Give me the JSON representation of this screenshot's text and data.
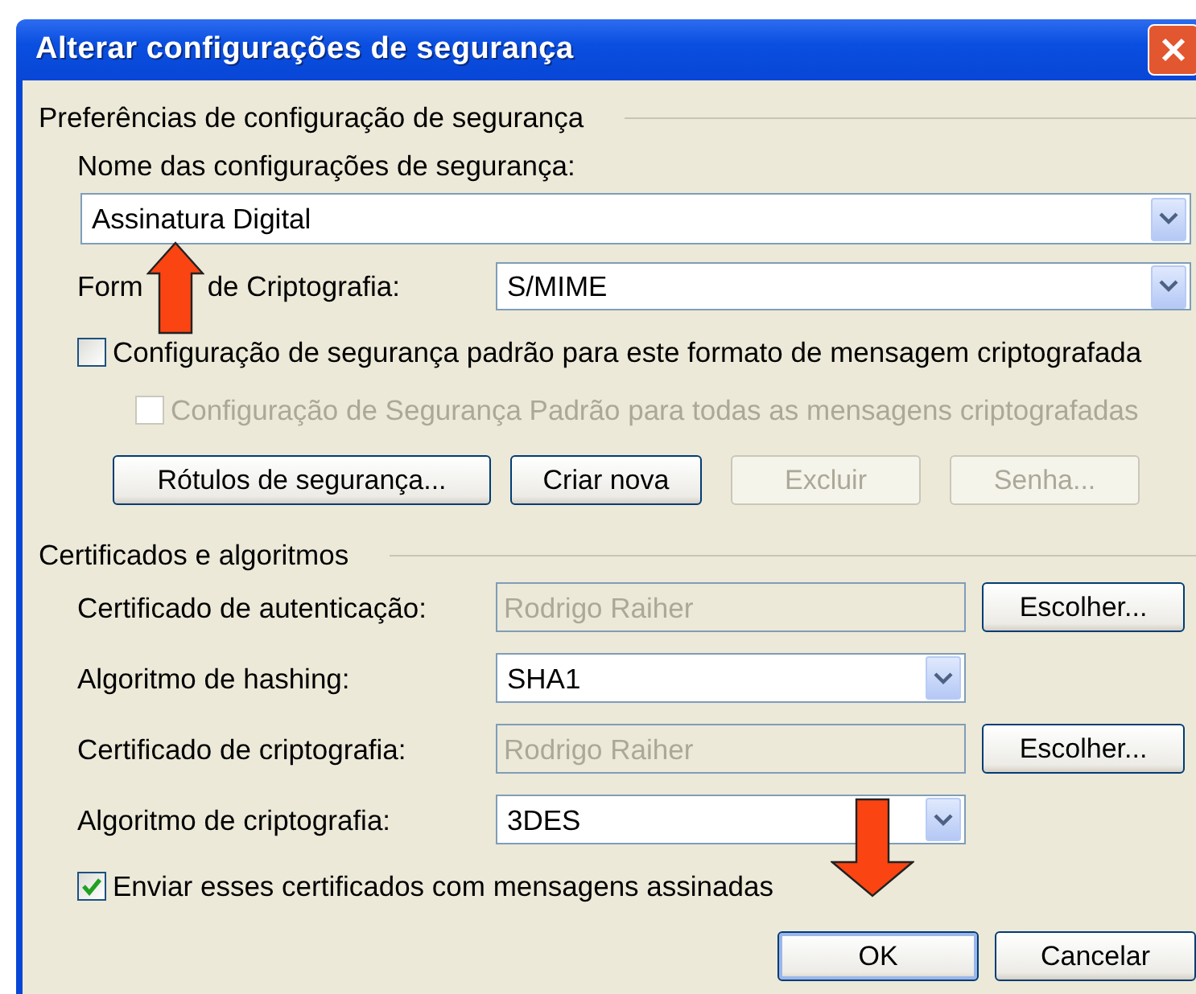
{
  "window": {
    "title": "Alterar configurações de segurança"
  },
  "preferences": {
    "heading": "Preferências de configuração de segurança",
    "name_label": "Nome das configurações de segurança:",
    "name_value": "Assinatura Digital",
    "format_label_parts": [
      "Form",
      "de Criptografia:"
    ],
    "format_value": "S/MIME",
    "checkboxes": [
      {
        "label": "Configuração de segurança padrão para este formato de mensagem criptografada",
        "checked": false,
        "disabled": false
      },
      {
        "label": "Configuração de Segurança Padrão para todas as mensagens criptografadas",
        "checked": false,
        "disabled": true
      }
    ],
    "buttons": [
      {
        "label": "Rótulos de segurança...",
        "disabled": false
      },
      {
        "label": "Criar nova",
        "disabled": false
      },
      {
        "label": "Excluir",
        "disabled": true
      },
      {
        "label": "Senha...",
        "disabled": true
      }
    ]
  },
  "certificates": {
    "heading": "Certificados e algoritmos",
    "rows": [
      {
        "kind": "readonly",
        "label": "Certificado de autenticação:",
        "value": "Rodrigo Raiher",
        "button": "Escolher..."
      },
      {
        "kind": "dropdown",
        "label": "Algoritmo de hashing:",
        "value": "SHA1"
      },
      {
        "kind": "readonly",
        "label": "Certificado de criptografia:",
        "value": "Rodrigo Raiher",
        "button": "Escolher..."
      },
      {
        "kind": "dropdown",
        "label": "Algoritmo de criptografia:",
        "value": "3DES"
      }
    ],
    "send_checkbox": {
      "label": "Enviar esses certificados com mensagens assinadas",
      "checked": true,
      "disabled": false
    }
  },
  "buttons": [
    {
      "label": "OK",
      "default": true
    },
    {
      "label": "Cancelar",
      "default": false
    }
  ]
}
